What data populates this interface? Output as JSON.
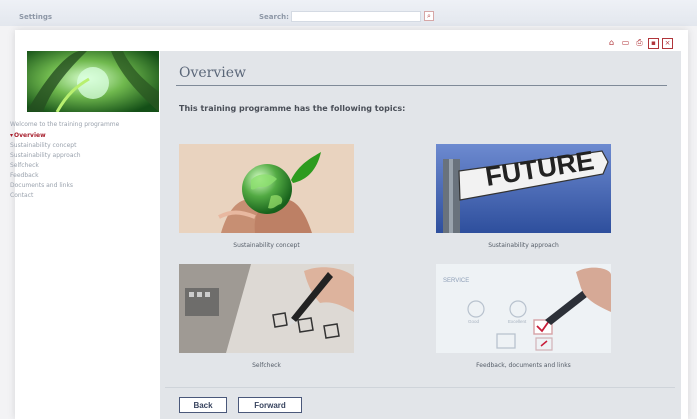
{
  "topbar": {
    "settings_label": "Settings",
    "search_label": "Search:",
    "search_value": ""
  },
  "toolbar": {
    "icons": [
      "home-icon",
      "folder-icon",
      "print-icon",
      "save-icon",
      "close-icon"
    ]
  },
  "sidebar": {
    "items": [
      {
        "label": "Welcome to the training programme",
        "active": false
      },
      {
        "label": "Overview",
        "active": true
      },
      {
        "label": "Sustainability concept",
        "active": false
      },
      {
        "label": "Sustainability approach",
        "active": false
      },
      {
        "label": "Selfcheck",
        "active": false
      },
      {
        "label": "Feedback",
        "active": false
      },
      {
        "label": "Documents and links",
        "active": false
      },
      {
        "label": "Contact",
        "active": false
      }
    ]
  },
  "main": {
    "title": "Overview",
    "intro": "This training programme has the following topics:",
    "topics": [
      {
        "caption": "Sustainability concept"
      },
      {
        "caption": "Sustainability approach"
      },
      {
        "caption": "Selfcheck"
      },
      {
        "caption": "Feedback, documents and links"
      }
    ],
    "future_sign_text": "FUTURE",
    "form_words": [
      "SERVICE",
      "Good",
      "Excellent"
    ],
    "back_label": "Back",
    "forward_label": "Forward"
  },
  "colors": {
    "accent": "#a71f2d",
    "panel": "#e2e5e9",
    "nav_text": "#9aa2ad"
  }
}
